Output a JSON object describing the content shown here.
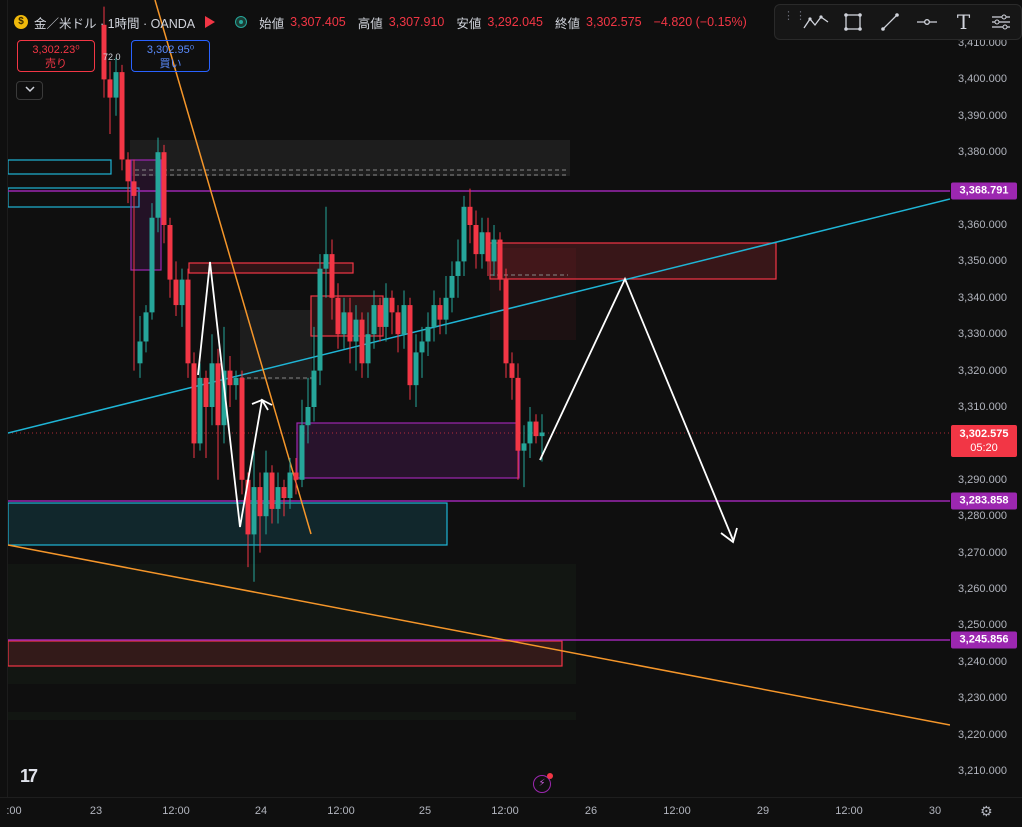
{
  "header": {
    "symbol_title": "金／米ドル · 1時間 · OANDA",
    "coin_glyph": "$",
    "open_label": "始値",
    "open_value": "3,307.405",
    "high_label": "高値",
    "high_value": "3,307.910",
    "low_label": "安値",
    "low_value": "3,292.045",
    "close_label": "終値",
    "close_value": "3,302.575",
    "change_value": "−4.820 (−0.15%)"
  },
  "trade_panel": {
    "sell_price": "3,302.23⁰",
    "sell_label": "売り",
    "buy_price": "3,302.95⁰",
    "buy_label": "買い",
    "spread": "72.0"
  },
  "toolbar": {
    "tools": [
      "trend-pattern-icon",
      "rectangle-icon",
      "trend-line-icon",
      "horizontal-ray-icon",
      "text-icon",
      "settings-sliders-icon"
    ],
    "text_tool_glyph": "T"
  },
  "price_axis": {
    "ticks": [
      "3,410.000",
      "3,400.000",
      "3,390.000",
      "3,380.000",
      "3,370.000",
      "3,360.000",
      "3,350.000",
      "3,340.000",
      "3,330.000",
      "3,320.000",
      "3,310.000",
      "3,300.000",
      "3,290.000",
      "3,280.000",
      "3,270.000",
      "3,260.000",
      "3,250.000",
      "3,240.000",
      "3,230.000",
      "3,220.000",
      "3,210.000"
    ],
    "tags": {
      "level_1": "3,368.791",
      "current_price": "3,302.575",
      "countdown": "05:20",
      "level_2": "3,283.858",
      "level_3": "3,245.856"
    }
  },
  "time_axis": {
    "ticks": [
      ":00",
      "23",
      "12:00",
      "24",
      "12:00",
      "25",
      "12:00",
      "26",
      "12:00",
      "29",
      "12:00",
      "30"
    ]
  },
  "colors": {
    "up": "#26a69a",
    "down": "#f23645",
    "accent_purple": "#9c27b0",
    "trend_orange": "#f5962a",
    "trend_cyan": "#1fb5d6"
  },
  "footer": {
    "logo_text": "17",
    "bolt_glyph": "⚡",
    "settings_glyph": "⚙"
  }
}
